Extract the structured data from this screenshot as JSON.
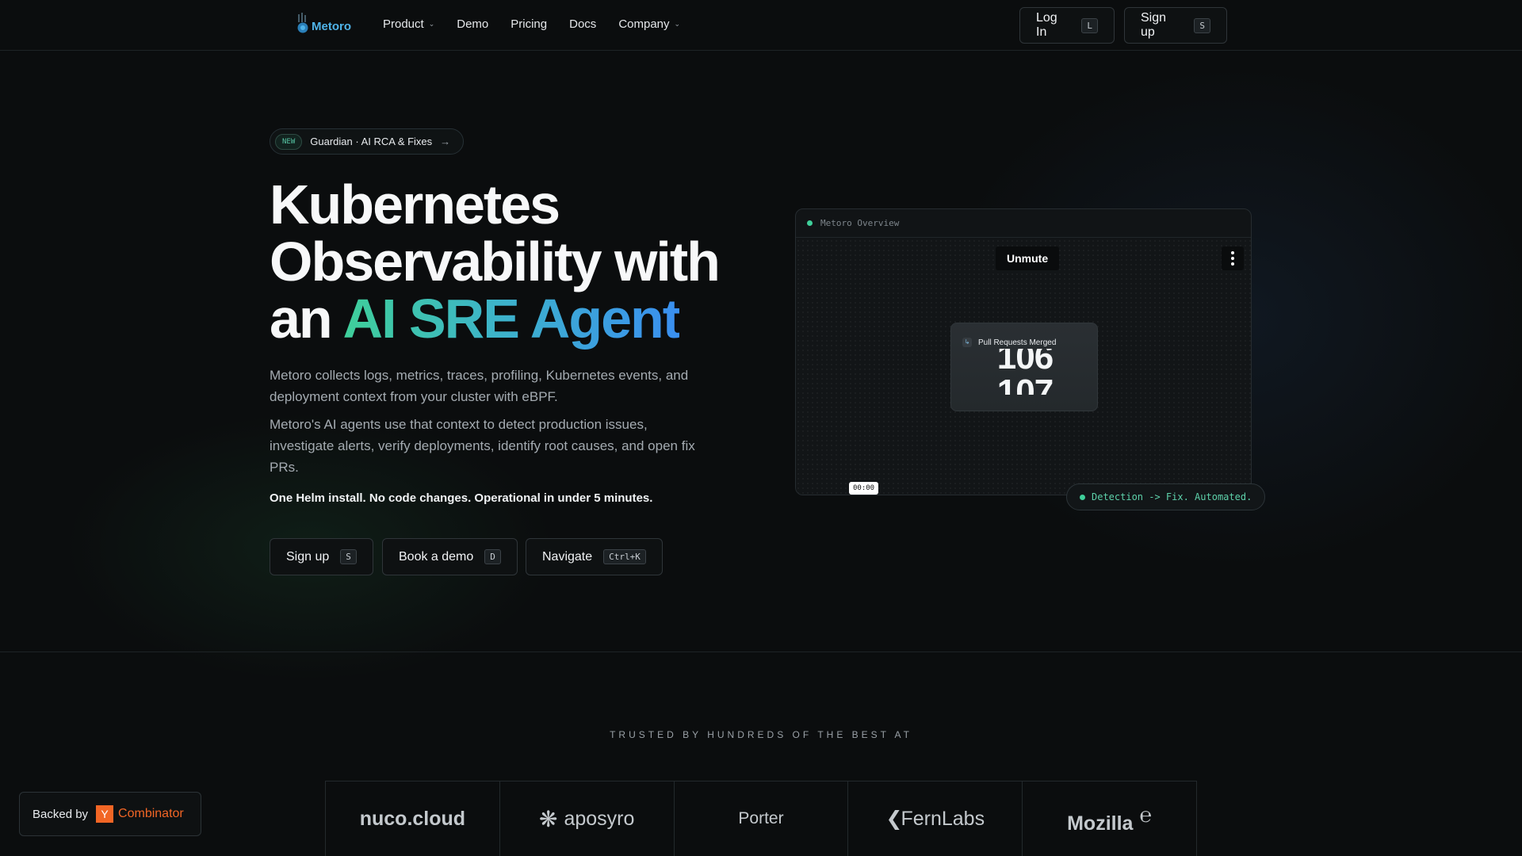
{
  "header": {
    "brand": "Metoro",
    "nav": [
      {
        "label": "Product",
        "has_dropdown": true
      },
      {
        "label": "Demo",
        "has_dropdown": false
      },
      {
        "label": "Pricing",
        "has_dropdown": false
      },
      {
        "label": "Docs",
        "has_dropdown": false
      },
      {
        "label": "Company",
        "has_dropdown": true
      }
    ],
    "login_label": "Log In",
    "login_key": "L",
    "signup_label": "Sign up",
    "signup_key": "S"
  },
  "badge": {
    "tag": "NEW",
    "text": "Guardian · AI RCA & Fixes",
    "arrow": "→"
  },
  "hero": {
    "headline_line1": "Kubernetes",
    "headline_line2": "Observability with",
    "headline_line3_plain": "an ",
    "headline_line3_highlight": "AI SRE Agent",
    "para1": "Metoro collects logs, metrics, traces, profiling, Kubernetes events, and deployment context from your cluster with eBPF.",
    "para2": "Metoro's AI agents use that context to detect production issues, investigate alerts, verify deployments, identify root causes, and open fix PRs.",
    "tagline": "One Helm install. No code changes. Operational in under 5 minutes.",
    "ctas": [
      {
        "label": "Sign up",
        "key": "S"
      },
      {
        "label": "Book a demo",
        "key": "D"
      },
      {
        "label": "Navigate",
        "key": "Ctrl+K"
      }
    ]
  },
  "video": {
    "window_title": "Metoro Overview",
    "unmute_label": "Unmute",
    "card_title": "Pull Requests Merged",
    "count_current": "106",
    "count_next": "107",
    "timestamp": "00:00",
    "progress": 0.11,
    "detection_chip": "Detection -> Fix. Automated."
  },
  "trusted": {
    "heading": "TRUSTED BY HUNDREDS OF THE BEST AT",
    "logos": [
      "nuco.cloud",
      "aposyro",
      "Porter",
      "FernLabs",
      "Mozilla"
    ]
  },
  "backed": {
    "label": "Backed by",
    "yc_letter": "Y",
    "yc_name": "Combinator"
  },
  "colors": {
    "accent_green": "#3fcf9a",
    "accent_blue": "#3a8ff0",
    "yc_orange": "#f26625",
    "background": "#0b0d0e"
  }
}
